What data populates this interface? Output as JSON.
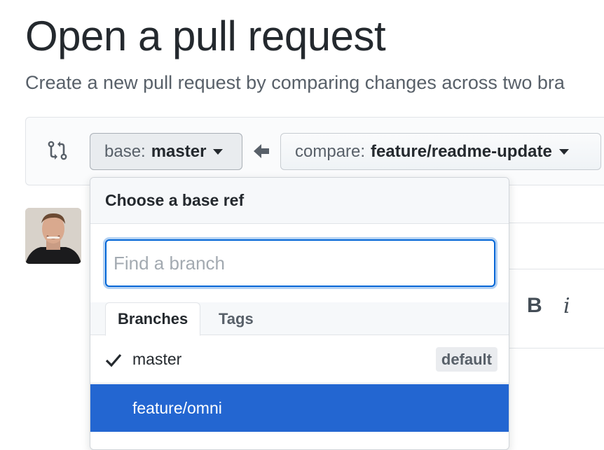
{
  "page": {
    "title": "Open a pull request",
    "subtitle": "Create a new pull request by comparing changes across two bra"
  },
  "range": {
    "base_label": "base:",
    "base_ref": "master",
    "compare_label": "compare:",
    "compare_ref": "feature/readme-update"
  },
  "toolbar": {
    "bold_label": "B",
    "italic_label": "i"
  },
  "dropdown": {
    "header": "Choose a base ref",
    "filter_placeholder": "Find a branch",
    "filter_value": "",
    "tabs": [
      {
        "label": "Branches",
        "active": true
      },
      {
        "label": "Tags",
        "active": false
      }
    ],
    "items": [
      {
        "name": "master",
        "checked": true,
        "badge": "default"
      },
      {
        "name": "feature/omni",
        "checked": false,
        "highlighted": true
      }
    ]
  },
  "colors": {
    "accent": "#0366d6",
    "highlight": "#2366d1",
    "text": "#24292e",
    "muted": "#586069"
  },
  "icons": [
    "git-compare-icon",
    "arrow-left-icon",
    "caret-down-icon",
    "check-icon"
  ]
}
